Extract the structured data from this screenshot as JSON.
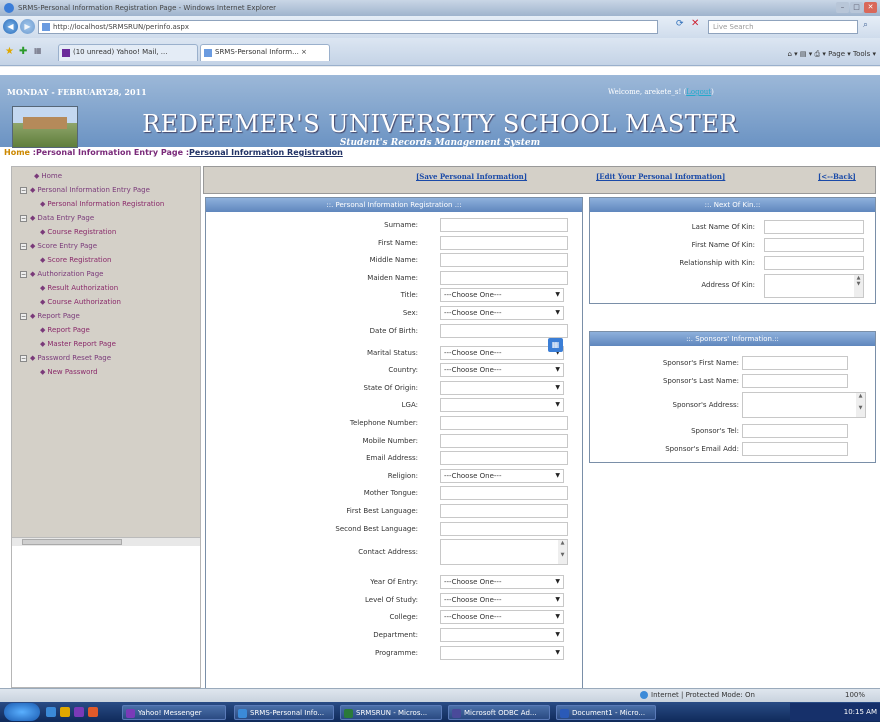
{
  "window": {
    "title": "SRMS-Personal Information Registration Page - Windows Internet Explorer"
  },
  "browser": {
    "url": "http://localhost/SRMSRUN/perinfo.aspx",
    "search_placeholder": "Live Search",
    "tabs": [
      {
        "label": "(10 unread) Yahoo! Mail, ..."
      },
      {
        "label": "SRMS-Personal Inform... ×"
      }
    ],
    "command_bar": "Page ▾  Tools ▾"
  },
  "header": {
    "date": "MONDAY - FEBRUARY28, 2011",
    "welcome_prefix": "Welcome, arekete_s! (",
    "logout_label": "Logout",
    "welcome_suffix": ")",
    "title": "REDEEMER'S UNIVERSITY SCHOOL MASTER",
    "subtitle": "Student's Records Management System"
  },
  "breadcrumb": {
    "home": "Home",
    "sep1": " :",
    "level1": "Personal Information Entry Page",
    "sep2": " :",
    "level2": "Personal Information Registration"
  },
  "sidebar": {
    "items": [
      {
        "label": "Home"
      },
      {
        "label": "Personal Information Entry Page"
      },
      {
        "label": "Personal Information Registration"
      },
      {
        "label": "Data Entry Page"
      },
      {
        "label": "Course Registration"
      },
      {
        "label": "Score Entry Page"
      },
      {
        "label": "Score Registration"
      },
      {
        "label": "Authorization Page"
      },
      {
        "label": "Result Authorization"
      },
      {
        "label": "Course Authorization"
      },
      {
        "label": "Report Page"
      },
      {
        "label": "Report Page"
      },
      {
        "label": "Master Report Page"
      },
      {
        "label": "Password Reset Page"
      },
      {
        "label": "New Password"
      }
    ]
  },
  "actions": {
    "save": "[Save Personal Information]",
    "edit": "[Edit Your Personal Information]",
    "back": "[<--Back]"
  },
  "personal": {
    "heading": "::. Personal Information Registration .::",
    "fields": [
      {
        "label": "Surname:",
        "type": "input"
      },
      {
        "label": "First Name:",
        "type": "input"
      },
      {
        "label": "Middle Name:",
        "type": "input"
      },
      {
        "label": "Maiden Name:",
        "type": "input"
      },
      {
        "label": "Title:",
        "type": "select",
        "value": "---Choose One---"
      },
      {
        "label": "Sex:",
        "type": "select",
        "value": "---Choose One---"
      },
      {
        "label": "Date Of Birth:",
        "type": "date"
      },
      {
        "label": "Marital Status:",
        "type": "select",
        "value": "---Choose One---"
      },
      {
        "label": "Country:",
        "type": "select",
        "value": "---Choose One---"
      },
      {
        "label": "State Of Origin:",
        "type": "select",
        "value": ""
      },
      {
        "label": "LGA:",
        "type": "select",
        "value": ""
      },
      {
        "label": "Telephone Number:",
        "type": "input"
      },
      {
        "label": "Mobile Number:",
        "type": "input"
      },
      {
        "label": "Email Address:",
        "type": "input"
      },
      {
        "label": "Religion:",
        "type": "select",
        "value": "---Choose One---"
      },
      {
        "label": "Mother Tongue:",
        "type": "input"
      },
      {
        "label": "First Best Language:",
        "type": "input"
      },
      {
        "label": "Second Best Language:",
        "type": "input"
      },
      {
        "label": "Contact Address:",
        "type": "textarea"
      },
      {
        "label": "Year Of Entry:",
        "type": "select",
        "value": "---Choose One---"
      },
      {
        "label": "Level Of Study:",
        "type": "select",
        "value": "---Choose One---"
      },
      {
        "label": "College:",
        "type": "select",
        "value": "---Choose One---"
      },
      {
        "label": "Department:",
        "type": "select",
        "value": ""
      },
      {
        "label": "Programme:",
        "type": "select",
        "value": ""
      }
    ]
  },
  "kin": {
    "heading": "::. Next Of Kin.::",
    "fields": [
      {
        "label": "Last Name Of Kin:"
      },
      {
        "label": "First Name Of Kin:"
      },
      {
        "label": "Relationship with Kin:"
      },
      {
        "label": "Address Of Kin:"
      }
    ]
  },
  "sponsor": {
    "heading": "::. Sponsors' Information.::",
    "fields": [
      {
        "label": "Sponsor's First Name:"
      },
      {
        "label": "Sponsor's Last Name:"
      },
      {
        "label": "Sponsor's Address:"
      },
      {
        "label": "Sponsor's Tel:"
      },
      {
        "label": "Sponsor's Email Add:"
      }
    ]
  },
  "status": {
    "zone": "Internet | Protected Mode: On",
    "zoom": "100%"
  },
  "taskbar": {
    "items": [
      {
        "label": "Yahoo! Messenger"
      },
      {
        "label": "SRMS-Personal Info..."
      },
      {
        "label": "SRMSRUN - Micros..."
      },
      {
        "label": "Microsoft ODBC Ad..."
      },
      {
        "label": "Document1 - Micro..."
      }
    ],
    "clock": "10:15 AM"
  },
  "colors": {
    "banner": "#7ba0cc",
    "panel_head": "#6f94c8",
    "link": "#1a4aa8",
    "menu_bg": "#d4d0c8"
  }
}
